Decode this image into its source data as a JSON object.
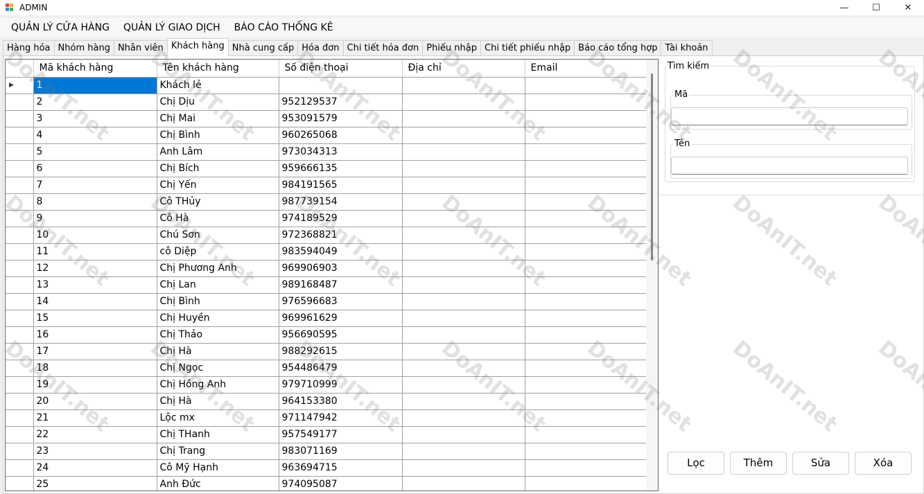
{
  "window": {
    "title": "ADMIN",
    "minimize": "—",
    "maximize": "☐",
    "close": "✕"
  },
  "menu": [
    "QUẢN LÝ CỬA HÀNG",
    "QUẢN LÝ GIAO DỊCH",
    "BÁO CÁO THỐNG KÊ"
  ],
  "tabs": [
    "Hàng hóa",
    "Nhóm hàng",
    "Nhân viên",
    "Khách hàng",
    "Nhà cung cấp",
    "Hóa đơn",
    "Chi tiết hóa đơn",
    "Phiếu nhập",
    "Chi tiết phiếu nhập",
    "Báo cáo tổng hợp",
    "Tài khoản"
  ],
  "active_tab": "Khách hàng",
  "grid": {
    "columns": [
      "Mã khách hàng",
      "Tên khách hàng",
      "Số điện thoại",
      "Địa chỉ",
      "Email"
    ],
    "current_row_marker": "▶",
    "rows": [
      [
        "1",
        "Khách lẻ",
        "",
        "",
        ""
      ],
      [
        "2",
        "Chị Dịu",
        "952129537",
        "",
        ""
      ],
      [
        "3",
        "Chị Mai",
        "953091579",
        "",
        ""
      ],
      [
        "4",
        "Chị Bình",
        "960265068",
        "",
        ""
      ],
      [
        "5",
        "Anh Lâm",
        "973034313",
        "",
        ""
      ],
      [
        "6",
        "Chị Bích",
        "959666135",
        "",
        ""
      ],
      [
        "7",
        "Chị Yến",
        "984191565",
        "",
        ""
      ],
      [
        "8",
        "Cô THủy",
        "987739154",
        "",
        ""
      ],
      [
        "9",
        "Cô Hà",
        "974189529",
        "",
        ""
      ],
      [
        "10",
        "Chú Sơn",
        "972368821",
        "",
        ""
      ],
      [
        "11",
        "cô Diệp",
        "983594049",
        "",
        ""
      ],
      [
        "12",
        "Chị Phương Anh",
        "969906903",
        "",
        ""
      ],
      [
        "13",
        "Chị Lan",
        "989168487",
        "",
        ""
      ],
      [
        "14",
        "Chị Bình",
        "976596683",
        "",
        ""
      ],
      [
        "15",
        "Chị Huyền",
        "969961629",
        "",
        ""
      ],
      [
        "16",
        "Chị Thảo",
        "956690595",
        "",
        ""
      ],
      [
        "17",
        "Chị Hà",
        "988292615",
        "",
        ""
      ],
      [
        "18",
        "Chị Ngọc",
        "954486479",
        "",
        ""
      ],
      [
        "19",
        "Chị Hồng Anh",
        "979710999",
        "",
        ""
      ],
      [
        "20",
        "Chị Hà",
        "964153380",
        "",
        ""
      ],
      [
        "21",
        "Lộc mx",
        "971147942",
        "",
        ""
      ],
      [
        "22",
        "Chị THanh",
        "957549177",
        "",
        ""
      ],
      [
        "23",
        "Chị Trang",
        "983071169",
        "",
        ""
      ],
      [
        "24",
        "Cô Mỹ Hạnh",
        "963694715",
        "",
        ""
      ],
      [
        "25",
        "Anh Đức",
        "974095087",
        "",
        ""
      ]
    ]
  },
  "search": {
    "title": "Tìm kiếm",
    "ma_label": "Mã",
    "ma_value": "",
    "ten_label": "Tên",
    "ten_value": ""
  },
  "buttons": {
    "loc": "Lọc",
    "them": "Thêm",
    "sua": "Sửa",
    "xoa": "Xóa"
  },
  "watermark": "DoAnIT.net",
  "colors": {
    "selection": "#0078d7",
    "background": "#f0f0f0"
  }
}
